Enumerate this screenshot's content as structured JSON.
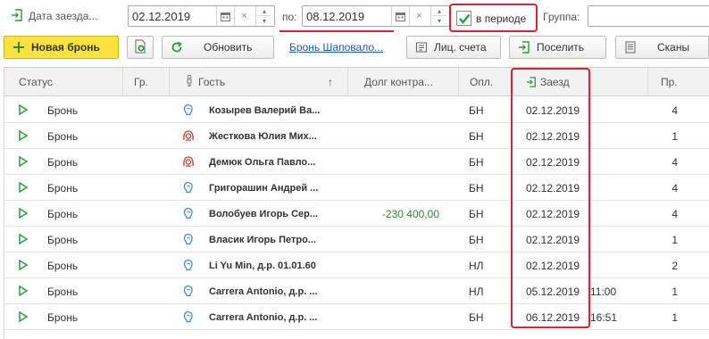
{
  "filter": {
    "checkin_label": "Дата заезда...",
    "date_from": "02.12.2019",
    "to_label": "по:",
    "date_to": "08.12.2019",
    "clear_glyph": "×",
    "in_period_label": "в периоде",
    "in_period_checked": true,
    "group_label": "Группа:",
    "group_value": ""
  },
  "toolbar": {
    "new_booking": "Новая бронь",
    "refresh": "Обновить",
    "booking_link": "Бронь Шаповало...",
    "accounts": "Лиц. счета",
    "checkin": "Поселить",
    "scans": "Сканы"
  },
  "table": {
    "columns": {
      "status": "Статус",
      "citizenship": "Гр.",
      "guest": "Гость",
      "sort_arrow": "↑",
      "debt": "Долг контра...",
      "payment": "Опл.",
      "arrival": "Заезд",
      "guests_count": "Пр."
    },
    "rows": [
      {
        "status": "Бронь",
        "gender": "male",
        "guest": "Козырев Валерий Ва...",
        "debt": "",
        "payment": "БН",
        "arrival": "02.12.2019",
        "arrival_time": "",
        "count": "4"
      },
      {
        "status": "Бронь",
        "gender": "female",
        "guest": "Жесткова Юлия Мих...",
        "debt": "",
        "payment": "БН",
        "arrival": "02.12.2019",
        "arrival_time": "",
        "count": "1"
      },
      {
        "status": "Бронь",
        "gender": "female",
        "guest": "Демюк Ольга Павло...",
        "debt": "",
        "payment": "БН",
        "arrival": "02.12.2019",
        "arrival_time": "",
        "count": "4"
      },
      {
        "status": "Бронь",
        "gender": "male",
        "guest": "Григорашин Андрей ...",
        "debt": "",
        "payment": "БН",
        "arrival": "02.12.2019",
        "arrival_time": "",
        "count": "4"
      },
      {
        "status": "Бронь",
        "gender": "male",
        "guest": "Волобуев Игорь Сер...",
        "debt": "-230 400,00",
        "payment": "БН",
        "arrival": "02.12.2019",
        "arrival_time": "",
        "count": "4"
      },
      {
        "status": "Бронь",
        "gender": "male",
        "guest": "Власик Игорь Петро...",
        "debt": "",
        "payment": "БН",
        "arrival": "02.12.2019",
        "arrival_time": "",
        "count": "1"
      },
      {
        "status": "Бронь",
        "gender": "male",
        "guest": "Li Yu Min, д.р. 01.01.60",
        "debt": "",
        "payment": "НЛ",
        "arrival": "02.12.2019",
        "arrival_time": "",
        "count": "2"
      },
      {
        "status": "Бронь",
        "gender": "male",
        "guest": "Carrera Antonio, д.р. ...",
        "debt": "",
        "payment": "НЛ",
        "arrival": "05.12.2019",
        "arrival_time": "11:00",
        "count": "1"
      },
      {
        "status": "Бронь",
        "gender": "male",
        "guest": "Carrera Antonio, д.р. ...",
        "debt": "",
        "payment": "БН",
        "arrival": "06.12.2019",
        "arrival_time": "16:51",
        "count": "1"
      }
    ]
  },
  "colors": {
    "accent_yellow": "#fbe240",
    "highlight_red": "#d9232f",
    "status_green": "#2e9b3e",
    "male_icon": "#3a86c8",
    "female_icon": "#c0392b",
    "link_blue": "#1e5aa8"
  },
  "icons": {
    "checkin": "enter-arrow-icon",
    "calendar": "calendar-icon",
    "clear": "clear-icon",
    "spin": "spin-icon",
    "checkbox": "checkmark-icon",
    "new_booking": "plus-icon",
    "print": "document-icon",
    "refresh": "refresh-icon",
    "accounts": "accounts-icon",
    "checkin_btn": "enter-arrow-icon",
    "scans": "scan-icon",
    "status": "play-triangle-icon",
    "male": "male-guest-icon",
    "female": "female-guest-icon"
  }
}
